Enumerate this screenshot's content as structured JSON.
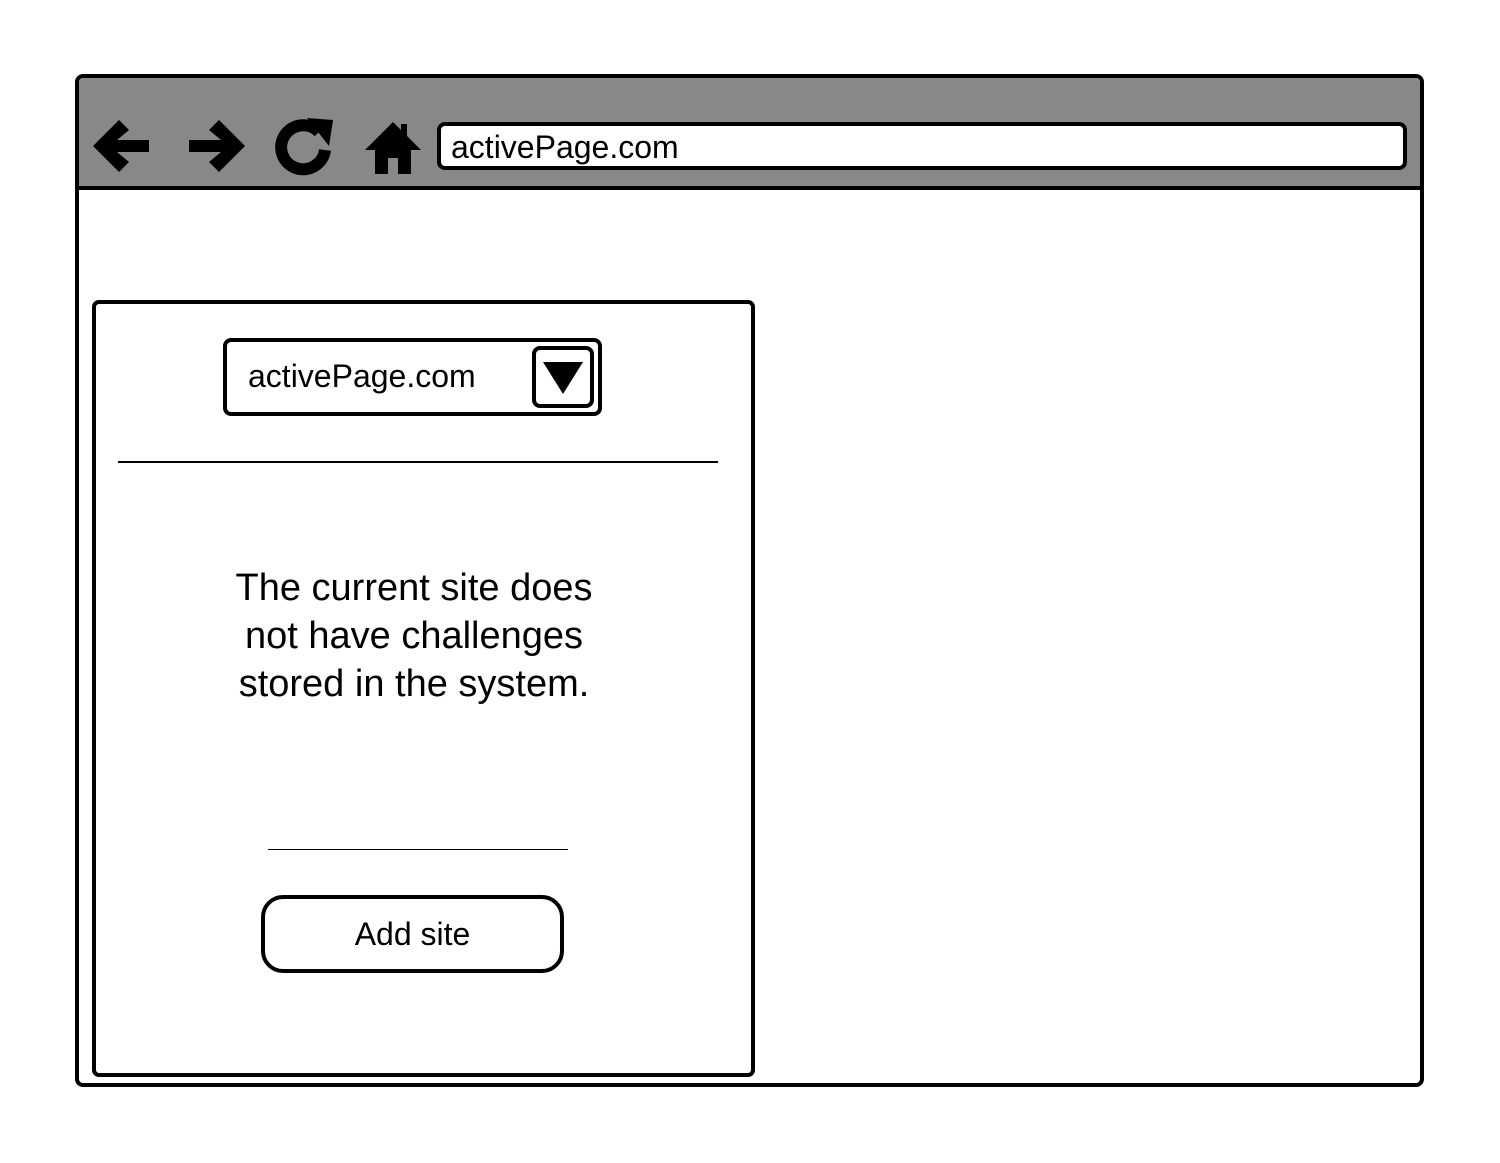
{
  "browser": {
    "address": "activePage.com",
    "toolbar_color": "#888888",
    "icons": [
      "back-arrow-icon",
      "forward-arrow-icon",
      "reload-icon",
      "home-icon"
    ]
  },
  "panel": {
    "site_select": {
      "selected": "activePage.com"
    },
    "message": "The current site does not have challenges stored in the system.",
    "add_site_label": "Add site"
  }
}
